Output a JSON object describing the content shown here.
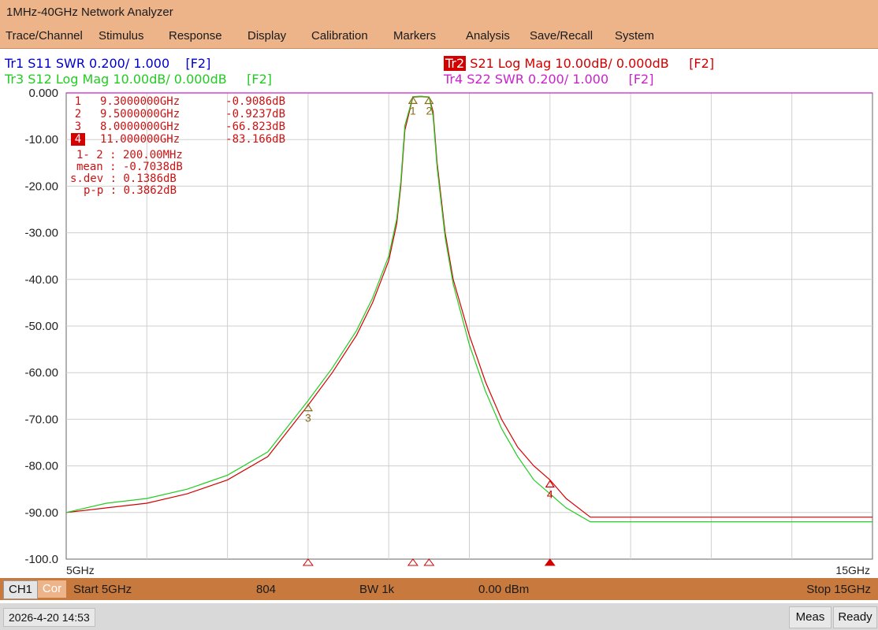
{
  "window": {
    "title": "1MHz-40GHz Network Analyzer"
  },
  "menu": [
    "Trace/Channel",
    "Stimulus",
    "Response",
    "Display",
    "Calibration",
    "Markers",
    "Analysis",
    "Save/Recall",
    "System"
  ],
  "traces": {
    "tr1": {
      "label": "Tr1 S11 SWR 0.200/ 1.000",
      "ref": "[F2]",
      "color": "#0000c8"
    },
    "tr2": {
      "tag": "Tr2",
      "label": "S21 Log Mag 10.00dB/ 0.000dB",
      "ref": "[F2]",
      "color": "#d40000"
    },
    "tr3": {
      "label": "Tr3 S12 Log Mag 10.00dB/ 0.000dB",
      "ref": "[F2]",
      "color": "#22cc22"
    },
    "tr4": {
      "label": "Tr4 S22 SWR 0.200/ 1.000",
      "ref": "[F2]",
      "color": "#cc22cc"
    }
  },
  "markers": [
    {
      "num": "1",
      "freq": "9.3000000GHz",
      "value": "-0.9086dB",
      "freq_ghz": 9.3,
      "db": -0.9086
    },
    {
      "num": "2",
      "freq": "9.5000000GHz",
      "value": "-0.9237dB",
      "freq_ghz": 9.5,
      "db": -0.9237
    },
    {
      "num": "3",
      "freq": "8.0000000GHz",
      "value": "-66.823dB",
      "freq_ghz": 8.0,
      "db": -66.823
    },
    {
      "num": "4",
      "freq": "11.000000GHz",
      "value": "-83.166dB",
      "freq_ghz": 11.0,
      "db": -83.166,
      "active": true
    }
  ],
  "stats": {
    "span": "1- 2 : 200.00MHz",
    "mean": "mean : -0.7038dB",
    "sdev": "s.dev : 0.1386dB",
    "pp": "p-p : 0.3862dB"
  },
  "chart_data": {
    "type": "line",
    "ylim": [
      -100,
      0
    ],
    "xlim": [
      5,
      15
    ],
    "x_unit": "GHz",
    "yticks": [
      "0.000",
      "-10.00",
      "-20.00",
      "-30.00",
      "-40.00",
      "-50.00",
      "-60.00",
      "-70.00",
      "-80.00",
      "-90.00",
      "-100.0"
    ],
    "x_start_label": "5GHz",
    "x_stop_label": "15GHz",
    "grid": true,
    "series": [
      {
        "name": "S21",
        "color": "#d40000",
        "x": [
          5.0,
          5.5,
          6.0,
          6.5,
          7.0,
          7.5,
          8.0,
          8.3,
          8.6,
          8.8,
          9.0,
          9.1,
          9.15,
          9.2,
          9.3,
          9.4,
          9.5,
          9.55,
          9.6,
          9.7,
          9.8,
          10.0,
          10.2,
          10.4,
          10.6,
          10.8,
          11.0,
          11.2,
          11.5,
          12.0,
          13.0,
          14.0,
          15.0
        ],
        "y": [
          -90,
          -89,
          -88,
          -86,
          -83,
          -78,
          -67,
          -60,
          -52,
          -45,
          -36,
          -28,
          -20,
          -8,
          -0.9,
          -0.8,
          -0.92,
          -4,
          -15,
          -30,
          -40,
          -52,
          -62,
          -70,
          -76,
          -80,
          -83,
          -87,
          -91,
          -91,
          -91,
          -91,
          -91
        ]
      },
      {
        "name": "S12",
        "color": "#22cc22",
        "x": [
          5.0,
          5.5,
          6.0,
          6.5,
          7.0,
          7.5,
          8.0,
          8.3,
          8.6,
          8.8,
          9.0,
          9.1,
          9.15,
          9.2,
          9.3,
          9.4,
          9.5,
          9.55,
          9.6,
          9.7,
          9.8,
          10.0,
          10.2,
          10.4,
          10.6,
          10.8,
          11.0,
          11.2,
          11.5,
          12.0,
          13.0,
          14.0,
          15.0
        ],
        "y": [
          -90,
          -88,
          -87,
          -85,
          -82,
          -77,
          -66,
          -59,
          -51,
          -44,
          -35,
          -27,
          -19,
          -7,
          -0.8,
          -0.7,
          -0.85,
          -5,
          -16,
          -31,
          -41,
          -54,
          -64,
          -72,
          -78,
          -83,
          -86,
          -89,
          -92,
          -92,
          -92,
          -92,
          -92
        ]
      }
    ]
  },
  "status": {
    "channel": "CH1",
    "cor": "Cor",
    "start": "Start 5GHz",
    "points": "804",
    "bw": "BW 1k",
    "power": "0.00 dBm",
    "stop": "Stop 15GHz"
  },
  "bottom": {
    "datetime": "2026-4-20 14:53",
    "meas": "Meas",
    "ready": "Ready"
  }
}
